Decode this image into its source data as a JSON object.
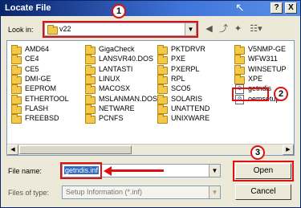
{
  "window": {
    "title": "Locate File",
    "help_btn": "?",
    "close_btn": "X"
  },
  "look_in": {
    "label": "Look in:",
    "value": "v22"
  },
  "toolbar": {
    "back_icon": "back-arrow-icon",
    "up_icon": "up-folder-icon",
    "new_folder_icon": "new-folder-icon",
    "views_icon": "views-menu-icon"
  },
  "items": [
    {
      "name": "AMD64",
      "type": "folder"
    },
    {
      "name": "CE4",
      "type": "folder"
    },
    {
      "name": "CE5",
      "type": "folder"
    },
    {
      "name": "DMI-GE",
      "type": "folder"
    },
    {
      "name": "EEPROM",
      "type": "folder"
    },
    {
      "name": "ETHERTOOL",
      "type": "folder"
    },
    {
      "name": "FLASH",
      "type": "folder"
    },
    {
      "name": "FREEBSD",
      "type": "folder"
    },
    {
      "name": "GigaCheck",
      "type": "folder"
    },
    {
      "name": "LANSVR40.DOS",
      "type": "folder"
    },
    {
      "name": "LANTASTI",
      "type": "folder"
    },
    {
      "name": "LINUX",
      "type": "folder"
    },
    {
      "name": "MACOSX",
      "type": "folder"
    },
    {
      "name": "MSLANMAN.DOS",
      "type": "folder"
    },
    {
      "name": "NETWARE",
      "type": "folder"
    },
    {
      "name": "PCNFS",
      "type": "folder"
    },
    {
      "name": "PKTDRVR",
      "type": "folder"
    },
    {
      "name": "PXE",
      "type": "folder"
    },
    {
      "name": "PXERPL",
      "type": "folder"
    },
    {
      "name": "RPL",
      "type": "folder"
    },
    {
      "name": "SCO5",
      "type": "folder"
    },
    {
      "name": "SOLARIS",
      "type": "folder"
    },
    {
      "name": "UNATTEND",
      "type": "folder"
    },
    {
      "name": "UNIXWARE",
      "type": "folder"
    },
    {
      "name": "V5NMP-GE",
      "type": "folder"
    },
    {
      "name": "WFW311",
      "type": "folder"
    },
    {
      "name": "WINSETUP",
      "type": "folder"
    },
    {
      "name": "XPE",
      "type": "folder"
    },
    {
      "name": "getndis",
      "type": "file"
    },
    {
      "name": "oemsetup",
      "type": "file"
    }
  ],
  "file_name": {
    "label": "File name:",
    "value": "getndis.inf"
  },
  "file_type": {
    "label": "Files of type:",
    "value": "Setup Information (*.inf)"
  },
  "buttons": {
    "open": "Open",
    "cancel": "Cancel"
  },
  "annotations": {
    "step1": "1",
    "step2": "2",
    "step3": "3",
    "color": "#e01010"
  }
}
